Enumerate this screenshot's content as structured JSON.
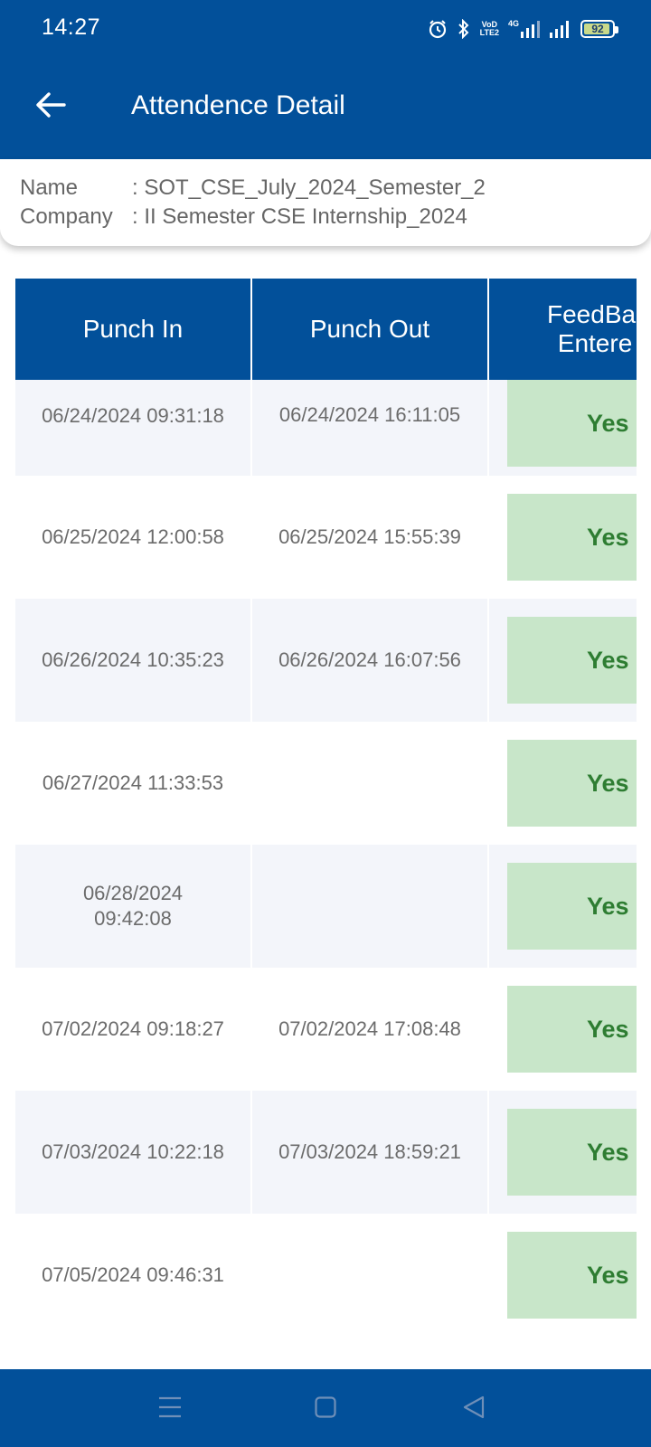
{
  "status_bar": {
    "time": "14:27",
    "volte_top": "VoD",
    "volte_bottom": "LTE2",
    "network_type": "4G",
    "battery_level": "92",
    "icons": [
      "alarm-icon",
      "bluetooth-icon",
      "volte-icon",
      "signal-4g-icon",
      "signal-icon",
      "battery-icon"
    ]
  },
  "app_bar": {
    "title": "Attendence Detail",
    "back_icon": "back-arrow-icon"
  },
  "info": {
    "name_label": "Name",
    "name_value": ": SOT_CSE_July_2024_Semester_2",
    "company_label": "Company",
    "company_value": ": II Semester CSE Internship_2024"
  },
  "table": {
    "headers": [
      "Punch In",
      "Punch Out",
      "FeedBack Entered"
    ],
    "header_feedback_line1": "FeedBa",
    "header_feedback_line2": "Entere",
    "rows": [
      {
        "punch_in": "06/24/2024 09:31:18",
        "punch_out": "06/24/2024 16:11:05",
        "feedback": "Yes"
      },
      {
        "punch_in": "06/25/2024 12:00:58",
        "punch_out": "06/25/2024 15:55:39",
        "feedback": "Yes"
      },
      {
        "punch_in": "06/26/2024 10:35:23",
        "punch_out": "06/26/2024 16:07:56",
        "feedback": "Yes"
      },
      {
        "punch_in": "06/27/2024 11:33:53",
        "punch_out": "",
        "feedback": "Yes"
      },
      {
        "punch_in": "06/28/2024 09:42:08",
        "punch_out": "",
        "feedback": "Yes"
      },
      {
        "punch_in": "07/02/2024 09:18:27",
        "punch_out": "07/02/2024 17:08:48",
        "feedback": "Yes"
      },
      {
        "punch_in": "07/03/2024 10:22:18",
        "punch_out": "07/03/2024 18:59:21",
        "feedback": "Yes"
      },
      {
        "punch_in": "07/05/2024 09:46:31",
        "punch_out": "",
        "feedback": "Yes"
      }
    ]
  },
  "nav_bar": {
    "icons": [
      "menu-icon",
      "home-icon",
      "back-triangle-icon"
    ]
  },
  "colors": {
    "primary": "#02509a",
    "row_alt": "#f3f5fa",
    "yes_bg": "#c8e6c9",
    "yes_text": "#2e7d32"
  }
}
